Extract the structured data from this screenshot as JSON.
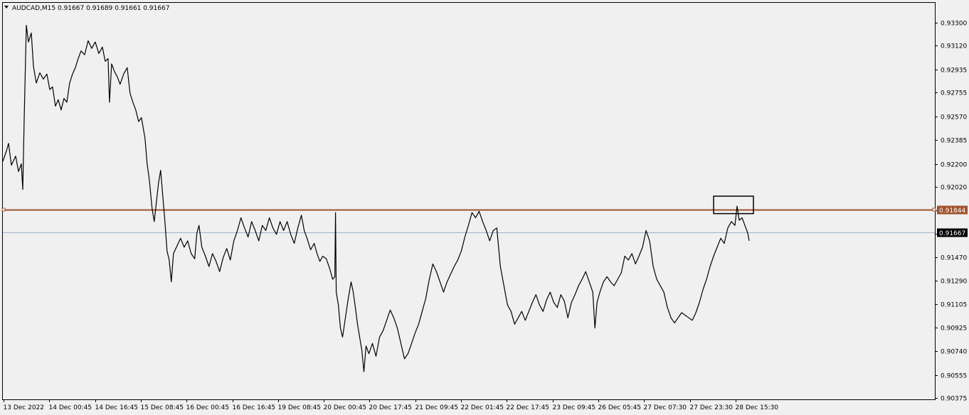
{
  "header": {
    "symbol_line": "AUDCAD,M15  0.91667 0.91689 0.91661 0.91667"
  },
  "chart_data": {
    "type": "line",
    "title": "AUDCAD,M15",
    "ohlc": {
      "open": 0.91667,
      "high": 0.91689,
      "low": 0.91661,
      "close": 0.91667
    },
    "ylim": [
      0.90375,
      0.9339
    ],
    "y_ticks": [
      0.933,
      0.9312,
      0.92935,
      0.92755,
      0.9257,
      0.92385,
      0.922,
      0.9202,
      0.91835,
      0.91655,
      0.9147,
      0.9129,
      0.91105,
      0.90925,
      0.9074,
      0.90555,
      0.90375
    ],
    "y_tick_labels": [
      "0.93300",
      "0.93120",
      "0.92935",
      "0.92755",
      "0.92570",
      "0.92385",
      "0.92200",
      "0.92020",
      "0.91470",
      "0.91290",
      "0.91105",
      "0.90925",
      "0.90740",
      "0.90555",
      "0.90375"
    ],
    "x_tick_labels": [
      "13 Dec 2022",
      "14 Dec 00:45",
      "14 Dec 16:45",
      "15 Dec 08:45",
      "16 Dec 00:45",
      "16 Dec 16:45",
      "19 Dec 08:45",
      "20 Dec 00:45",
      "20 Dec 17:45",
      "21 Dec 09:45",
      "22 Dec 01:45",
      "22 Dec 17:45",
      "23 Dec 09:45",
      "26 Dec 05:45",
      "27 Dec 07:30",
      "27 Dec 23:30",
      "28 Dec 15:30"
    ],
    "x_range": [
      0,
      1050
    ],
    "series": [
      {
        "color": "#000000",
        "points": [
          [
            0,
            0.9222
          ],
          [
            5,
            0.923
          ],
          [
            8,
            0.9236
          ],
          [
            12,
            0.9219
          ],
          [
            18,
            0.9226
          ],
          [
            22,
            0.9214
          ],
          [
            26,
            0.922
          ],
          [
            28,
            0.92
          ],
          [
            30,
            0.9255
          ],
          [
            33,
            0.9328
          ],
          [
            36,
            0.9315
          ],
          [
            40,
            0.9322
          ],
          [
            43,
            0.9296
          ],
          [
            47,
            0.9283
          ],
          [
            52,
            0.9291
          ],
          [
            57,
            0.9286
          ],
          [
            62,
            0.929
          ],
          [
            66,
            0.9278
          ],
          [
            70,
            0.928
          ],
          [
            74,
            0.9265
          ],
          [
            78,
            0.927
          ],
          [
            82,
            0.9262
          ],
          [
            86,
            0.9271
          ],
          [
            90,
            0.9268
          ],
          [
            94,
            0.9283
          ],
          [
            98,
            0.929
          ],
          [
            102,
            0.9295
          ],
          [
            106,
            0.9302
          ],
          [
            110,
            0.9308
          ],
          [
            115,
            0.9305
          ],
          [
            120,
            0.9316
          ],
          [
            125,
            0.931
          ],
          [
            130,
            0.9315
          ],
          [
            135,
            0.9306
          ],
          [
            140,
            0.9311
          ],
          [
            144,
            0.93
          ],
          [
            148,
            0.9302
          ],
          [
            150,
            0.9268
          ],
          [
            153,
            0.9298
          ],
          [
            157,
            0.9292
          ],
          [
            161,
            0.9288
          ],
          [
            165,
            0.9282
          ],
          [
            170,
            0.929
          ],
          [
            175,
            0.9295
          ],
          [
            179,
            0.9275
          ],
          [
            183,
            0.9268
          ],
          [
            187,
            0.9262
          ],
          [
            191,
            0.9253
          ],
          [
            195,
            0.9256
          ],
          [
            200,
            0.924
          ],
          [
            203,
            0.922
          ],
          [
            206,
            0.9208
          ],
          [
            210,
            0.9185
          ],
          [
            213,
            0.9175
          ],
          [
            216,
            0.919
          ],
          [
            219,
            0.9205
          ],
          [
            222,
            0.9215
          ],
          [
            225,
            0.9195
          ],
          [
            228,
            0.9175
          ],
          [
            231,
            0.9152
          ],
          [
            234,
            0.9145
          ],
          [
            237,
            0.9128
          ],
          [
            240,
            0.915
          ],
          [
            245,
            0.9156
          ],
          [
            250,
            0.9162
          ],
          [
            255,
            0.9155
          ],
          [
            260,
            0.916
          ],
          [
            265,
            0.915
          ],
          [
            270,
            0.9146
          ],
          [
            273,
            0.9166
          ],
          [
            276,
            0.9172
          ],
          [
            280,
            0.9155
          ],
          [
            285,
            0.9148
          ],
          [
            290,
            0.914
          ],
          [
            295,
            0.915
          ],
          [
            300,
            0.9144
          ],
          [
            305,
            0.9136
          ],
          [
            310,
            0.9147
          ],
          [
            315,
            0.9154
          ],
          [
            320,
            0.9145
          ],
          [
            325,
            0.916
          ],
          [
            330,
            0.9168
          ],
          [
            335,
            0.9178
          ],
          [
            340,
            0.917
          ],
          [
            345,
            0.9163
          ],
          [
            350,
            0.9175
          ],
          [
            355,
            0.9168
          ],
          [
            360,
            0.916
          ],
          [
            365,
            0.9172
          ],
          [
            370,
            0.9168
          ],
          [
            375,
            0.9178
          ],
          [
            380,
            0.917
          ],
          [
            385,
            0.9165
          ],
          [
            390,
            0.9175
          ],
          [
            395,
            0.9168
          ],
          [
            400,
            0.9175
          ],
          [
            405,
            0.9165
          ],
          [
            410,
            0.9158
          ],
          [
            415,
            0.917
          ],
          [
            420,
            0.918
          ],
          [
            424,
            0.9168
          ],
          [
            428,
            0.9162
          ],
          [
            433,
            0.9153
          ],
          [
            438,
            0.9158
          ],
          [
            442,
            0.915
          ],
          [
            446,
            0.9144
          ],
          [
            450,
            0.9148
          ],
          [
            455,
            0.9146
          ],
          [
            460,
            0.9138
          ],
          [
            464,
            0.913
          ],
          [
            467,
            0.9132
          ],
          [
            468,
            0.9182
          ],
          [
            469,
            0.912
          ],
          [
            472,
            0.911
          ],
          [
            475,
            0.9092
          ],
          [
            478,
            0.9085
          ],
          [
            482,
            0.91
          ],
          [
            486,
            0.9115
          ],
          [
            490,
            0.9128
          ],
          [
            493,
            0.912
          ],
          [
            496,
            0.9108
          ],
          [
            499,
            0.9095
          ],
          [
            502,
            0.9085
          ],
          [
            505,
            0.9075
          ],
          [
            508,
            0.9058
          ],
          [
            511,
            0.9078
          ],
          [
            515,
            0.9072
          ],
          [
            520,
            0.908
          ],
          [
            525,
            0.907
          ],
          [
            530,
            0.9085
          ],
          [
            535,
            0.909
          ],
          [
            540,
            0.9098
          ],
          [
            545,
            0.9106
          ],
          [
            550,
            0.91
          ],
          [
            555,
            0.9092
          ],
          [
            560,
            0.908
          ],
          [
            565,
            0.9068
          ],
          [
            570,
            0.9072
          ],
          [
            575,
            0.908
          ],
          [
            580,
            0.9088
          ],
          [
            585,
            0.9095
          ],
          [
            590,
            0.9105
          ],
          [
            595,
            0.9115
          ],
          [
            600,
            0.913
          ],
          [
            605,
            0.9142
          ],
          [
            610,
            0.9136
          ],
          [
            615,
            0.9128
          ],
          [
            620,
            0.912
          ],
          [
            625,
            0.9128
          ],
          [
            630,
            0.9134
          ],
          [
            635,
            0.914
          ],
          [
            640,
            0.9145
          ],
          [
            645,
            0.9152
          ],
          [
            650,
            0.9163
          ],
          [
            655,
            0.9172
          ],
          [
            660,
            0.9182
          ],
          [
            665,
            0.9178
          ],
          [
            670,
            0.9183
          ],
          [
            675,
            0.9175
          ],
          [
            680,
            0.9168
          ],
          [
            685,
            0.916
          ],
          [
            690,
            0.9168
          ],
          [
            695,
            0.917
          ],
          [
            700,
            0.914
          ],
          [
            705,
            0.9125
          ],
          [
            710,
            0.911
          ],
          [
            715,
            0.9105
          ],
          [
            720,
            0.9095
          ],
          [
            725,
            0.91
          ],
          [
            730,
            0.9105
          ],
          [
            735,
            0.9098
          ],
          [
            740,
            0.9105
          ],
          [
            745,
            0.9112
          ],
          [
            750,
            0.9118
          ],
          [
            755,
            0.911
          ],
          [
            760,
            0.9105
          ],
          [
            765,
            0.9114
          ],
          [
            770,
            0.912
          ],
          [
            775,
            0.9112
          ],
          [
            780,
            0.9108
          ],
          [
            785,
            0.9118
          ],
          [
            790,
            0.9113
          ],
          [
            795,
            0.91
          ],
          [
            800,
            0.9112
          ],
          [
            805,
            0.9118
          ],
          [
            810,
            0.9125
          ],
          [
            815,
            0.913
          ],
          [
            820,
            0.9136
          ],
          [
            825,
            0.9128
          ],
          [
            830,
            0.912
          ],
          [
            833,
            0.9092
          ],
          [
            836,
            0.9112
          ],
          [
            840,
            0.912
          ],
          [
            845,
            0.9128
          ],
          [
            850,
            0.9132
          ],
          [
            855,
            0.9128
          ],
          [
            860,
            0.9125
          ],
          [
            865,
            0.913
          ],
          [
            870,
            0.9135
          ],
          [
            875,
            0.9148
          ],
          [
            880,
            0.9145
          ],
          [
            885,
            0.915
          ],
          [
            890,
            0.9142
          ],
          [
            895,
            0.9148
          ],
          [
            900,
            0.9155
          ],
          [
            905,
            0.9168
          ],
          [
            910,
            0.916
          ],
          [
            915,
            0.914
          ],
          [
            920,
            0.913
          ],
          [
            925,
            0.9125
          ],
          [
            930,
            0.912
          ],
          [
            935,
            0.9108
          ],
          [
            940,
            0.91
          ],
          [
            945,
            0.9096
          ],
          [
            950,
            0.91
          ],
          [
            955,
            0.9104
          ],
          [
            960,
            0.9102
          ],
          [
            965,
            0.91
          ],
          [
            970,
            0.9098
          ],
          [
            975,
            0.9104
          ],
          [
            980,
            0.9112
          ],
          [
            985,
            0.9122
          ],
          [
            990,
            0.913
          ],
          [
            995,
            0.914
          ],
          [
            1000,
            0.9148
          ],
          [
            1005,
            0.9155
          ],
          [
            1010,
            0.9162
          ],
          [
            1015,
            0.9158
          ],
          [
            1020,
            0.917
          ],
          [
            1025,
            0.9175
          ],
          [
            1030,
            0.9172
          ],
          [
            1033,
            0.9187
          ],
          [
            1036,
            0.9176
          ],
          [
            1040,
            0.9178
          ],
          [
            1044,
            0.9172
          ],
          [
            1048,
            0.9166
          ],
          [
            1050,
            0.916
          ]
        ]
      }
    ],
    "horizontal_lines": [
      {
        "kind": "resistance",
        "value": 0.91844,
        "label": "0.91844",
        "color": "#a0522d"
      },
      {
        "kind": "bid",
        "value": 0.91667,
        "label": "0.91667",
        "color": "#9fb3c8"
      }
    ],
    "annotation_rectangle": {
      "x0": 1000,
      "x1": 1056,
      "y_top": 0.91948,
      "y_bottom": 0.91812,
      "color": "#000000"
    },
    "grid": false,
    "legend": "none"
  }
}
